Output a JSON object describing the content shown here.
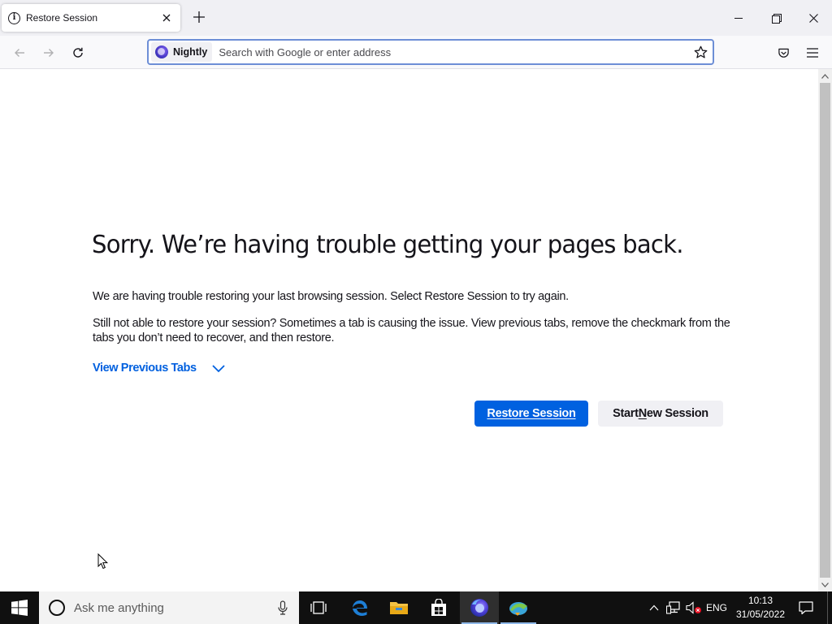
{
  "browser": {
    "tab": {
      "title": "Restore Session"
    },
    "urlbar": {
      "identity_label": "Nightly",
      "placeholder": "Search with Google or enter address"
    }
  },
  "page": {
    "title": "Sorry. We’re having trouble getting your pages back.",
    "paragraph1": "We are having trouble restoring your last browsing session. Select Restore Session to try again.",
    "paragraph2": "Still not able to restore your session? Sometimes a tab is causing the issue. View previous tabs, remove the checkmark from the tabs you don’t need to recover, and then restore.",
    "view_previous_tabs": "View Previous Tabs",
    "restore_button": "Restore Session",
    "new_session_button": {
      "before": "Start ",
      "accesskey": "N",
      "after": "ew Session"
    }
  },
  "taskbar": {
    "search_placeholder": "Ask me anything",
    "language": "ENG",
    "time": "10:13",
    "date": "31/05/2022"
  },
  "colors": {
    "accent": "#0061e0",
    "link": "#0060df",
    "taskbar": "#101010"
  }
}
